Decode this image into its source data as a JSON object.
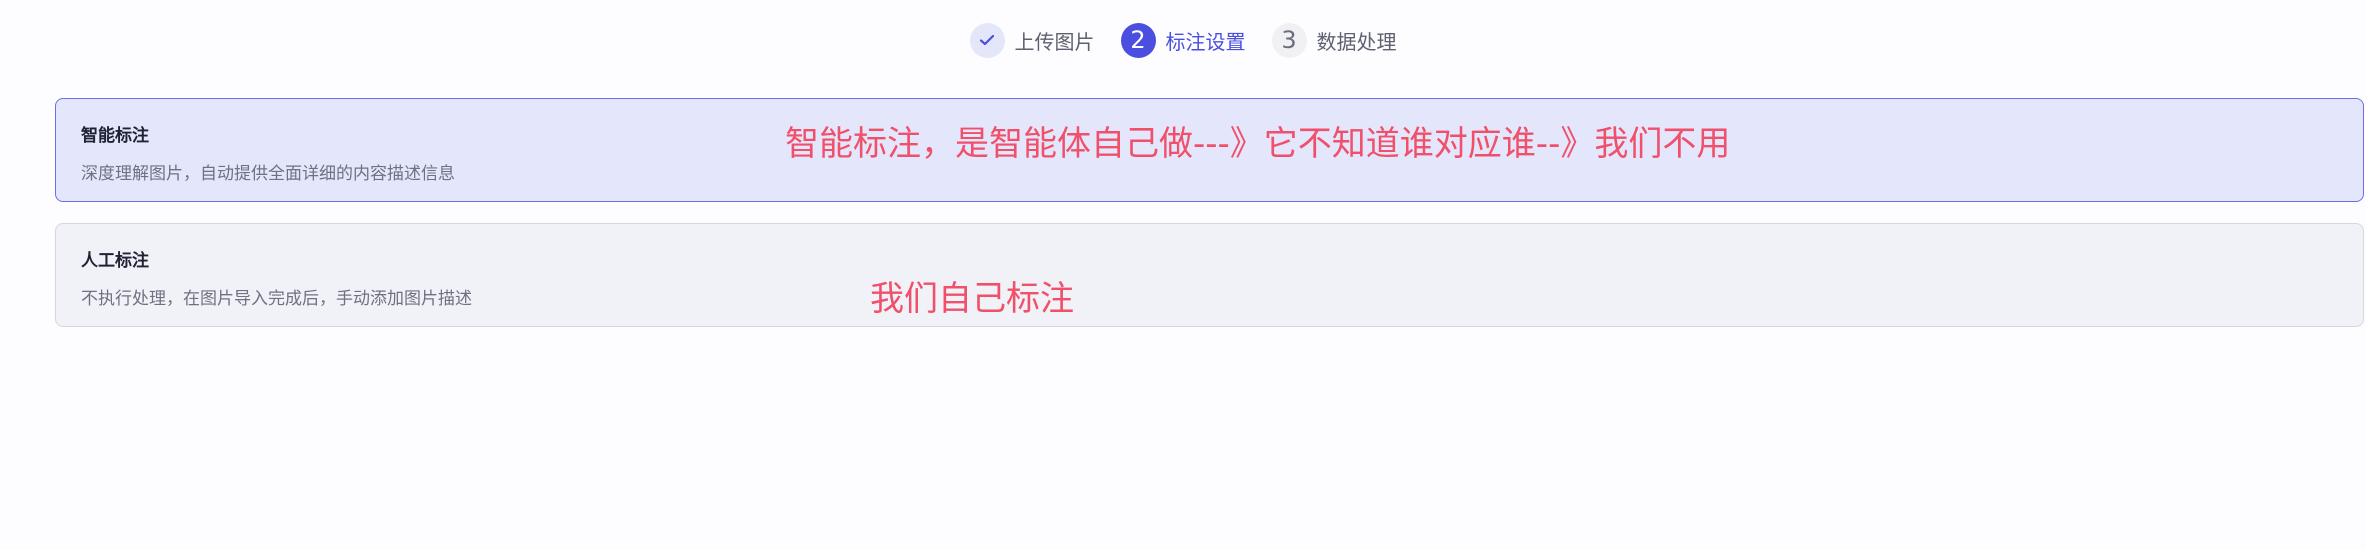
{
  "stepper": {
    "steps": [
      {
        "number": "",
        "label": "上传图片",
        "state": "done",
        "icon": "check-icon"
      },
      {
        "number": "2",
        "label": "标注设置",
        "state": "active"
      },
      {
        "number": "3",
        "label": "数据处理",
        "state": "pending"
      }
    ]
  },
  "options": [
    {
      "title": "智能标注",
      "description": "深度理解图片，自动提供全面详细的内容描述信息",
      "selected": true
    },
    {
      "title": "人工标注",
      "description": "不执行处理，在图片导入完成后，手动添加图片描述",
      "selected": false
    }
  ],
  "annotations": [
    "智能标注，是智能体自己做---》它不知道谁对应谁--》我们不用",
    "我们自己标注"
  ],
  "colors": {
    "accent": "#4a4fe0",
    "annotation_red": "#f0506a",
    "selected_card_bg": "#e4e6fc",
    "normal_card_bg": "#f1f1f8"
  }
}
